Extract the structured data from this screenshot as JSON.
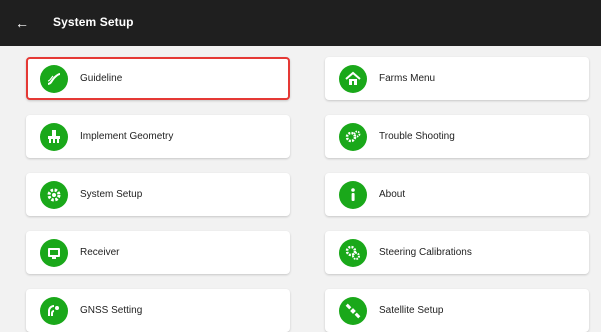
{
  "header": {
    "title": "System Setup",
    "back_icon": "back-arrow-icon"
  },
  "accent_color": "#1aa81a",
  "selected_outline_color": "#e53935",
  "menu": {
    "left": [
      {
        "label": "Guideline",
        "icon": "guideline-curve-icon",
        "selected": true
      },
      {
        "label": "Implement Geometry",
        "icon": "implement-geometry-icon"
      },
      {
        "label": "System Setup",
        "icon": "gear-icon"
      },
      {
        "label": "Receiver",
        "icon": "receiver-icon"
      },
      {
        "label": "GNSS Setting",
        "icon": "gnss-antenna-icon"
      }
    ],
    "right": [
      {
        "label": "Farms Menu",
        "icon": "house-icon"
      },
      {
        "label": "Trouble Shooting",
        "icon": "gears-icon"
      },
      {
        "label": "About",
        "icon": "info-icon"
      },
      {
        "label": "Steering Calibrations",
        "icon": "steering-gears-icon"
      },
      {
        "label": "Satellite Setup",
        "icon": "satellite-icon"
      }
    ]
  }
}
